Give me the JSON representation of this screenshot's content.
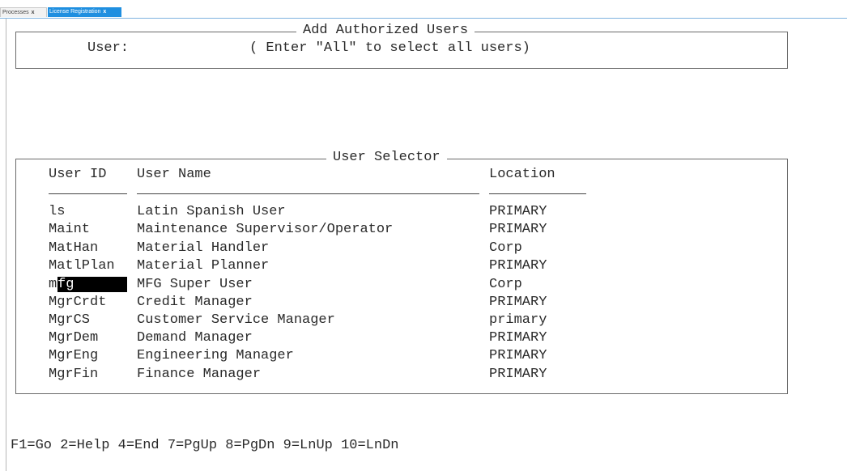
{
  "tabs": [
    {
      "label": "Processes",
      "close": "x"
    },
    {
      "label": "License Registration",
      "close": "x"
    }
  ],
  "add_users": {
    "title": "Add Authorized Users",
    "user_label": "User:",
    "hint": "( Enter \"All\" to select all users)"
  },
  "selector": {
    "title": "User Selector",
    "headers": {
      "id": "User ID",
      "name": "User Name",
      "location": "Location"
    },
    "rows": [
      {
        "id": "ls",
        "name": "Latin Spanish User",
        "location": "PRIMARY"
      },
      {
        "id": "Maint",
        "name": "Maintenance Supervisor/Operator",
        "location": "PRIMARY"
      },
      {
        "id": "MatHan",
        "name": "Material Handler",
        "location": "Corp"
      },
      {
        "id": "MatlPlan",
        "name": "Material Planner",
        "location": "PRIMARY"
      },
      {
        "id": "mfg",
        "name": "MFG Super User",
        "location": "Corp",
        "cursor_prefix": "m",
        "cursor_rest": "fg"
      },
      {
        "id": "MgrCrdt",
        "name": "Credit Manager",
        "location": "PRIMARY"
      },
      {
        "id": "MgrCS",
        "name": "Customer Service Manager",
        "location": "primary"
      },
      {
        "id": "MgrDem",
        "name": "Demand Manager",
        "location": "PRIMARY"
      },
      {
        "id": "MgrEng",
        "name": "Engineering Manager",
        "location": "PRIMARY"
      },
      {
        "id": "MgrFin",
        "name": "Finance Manager",
        "location": "PRIMARY"
      }
    ]
  },
  "function_keys": "F1=Go 2=Help 4=End 7=PgUp 8=PgDn 9=LnUp 10=LnDn"
}
